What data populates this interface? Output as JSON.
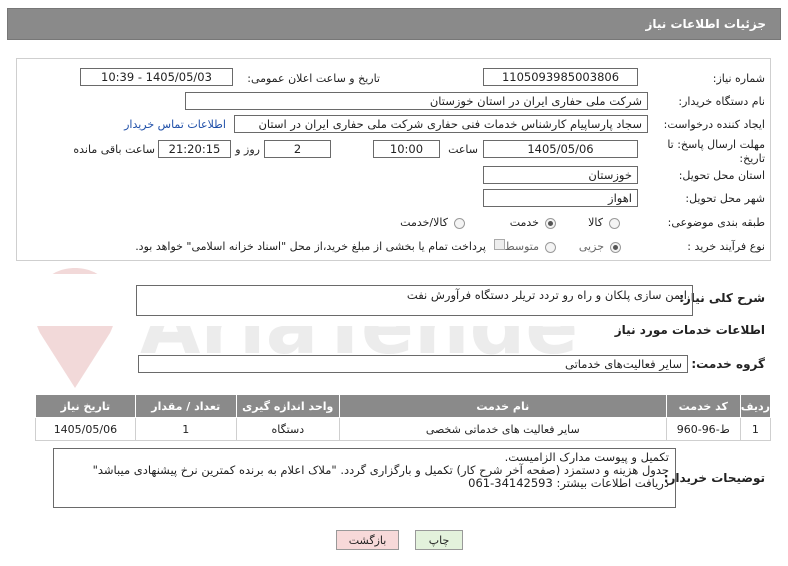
{
  "header": {
    "title": "جزئیات اطلاعات نیاز"
  },
  "fields": {
    "need_number_label": "شماره نیاز:",
    "need_number": "1105093985003806",
    "announce_label": "تاریخ و ساعت اعلان عمومی:",
    "announce_value": "1405/05/03 - 10:39",
    "buyer_org_label": "نام دستگاه خریدار:",
    "buyer_org": "شرکت ملی حفاری ایران در استان خوزستان",
    "requester_label": "ایجاد کننده درخواست:",
    "requester": "سجاد پارساپیام کارشناس خدمات فنی حفاری شرکت ملی حفاری ایران در استان",
    "contact_link": "اطلاعات تماس خریدار",
    "deadline_label_1": "مهلت ارسال پاسخ: تا",
    "deadline_label_2": "تاریخ:",
    "deadline_date": "1405/05/06",
    "time_label": "ساعت",
    "deadline_time": "10:00",
    "days_value": "2",
    "days_label": "روز و",
    "remaining_time": "21:20:15",
    "remaining_label": "ساعت باقی مانده",
    "province_label": "استان محل تحویل:",
    "province": "خوزستان",
    "city_label": "شهر محل تحویل:",
    "city": "اهواز",
    "category_label": "طبقه بندی موضوعی:",
    "category_options": [
      "کالا",
      "خدمت",
      "کالا/خدمت"
    ],
    "category_selected": "خدمت",
    "purchase_type_label": "نوع فرآیند خرید :",
    "purchase_options": [
      "جزیی",
      "متوسط"
    ],
    "purchase_selected": "جزیی",
    "payment_note": "پرداخت تمام یا بخشی از مبلغ خرید،از محل \"اسناد خزانه اسلامی\" خواهد بود."
  },
  "summary": {
    "label": "شرح کلی نیاز:",
    "value": "ایمن سازی پلکان و راه رو تردد تریلر دستگاه فرآورش نفت"
  },
  "services_title": "اطلاعات خدمات مورد نیاز",
  "service_group": {
    "label": "گروه خدمت:",
    "value": "سایر فعالیت‌های خدماتی"
  },
  "table": {
    "headers": [
      "ردیف",
      "کد خدمت",
      "نام خدمت",
      "واحد اندازه گیری",
      "تعداد / مقدار",
      "تاریخ نیاز"
    ],
    "rows": [
      [
        "1",
        "ط-96-960",
        "سایر فعالیت های خدماتی شخصی",
        "دستگاه",
        "1",
        "1405/05/06"
      ]
    ]
  },
  "buyer_notes": {
    "label": "توضیحات خریدار:",
    "line1": "تکمیل و پیوست مدارک الزامیست.",
    "line2": "جدول هزینه و دستمزد (صفحه آخر شرح کار) تکمیل و بارگزاری گردد. \"ملاک اعلام به برنده کمترین نرخ پیشنهادی میباشد\"",
    "line3": "دریافت اطلاعات بیشتر: 34142593-061"
  },
  "buttons": {
    "print": "چاپ",
    "back": "بازگشت"
  },
  "colors": {
    "header_bg": "#8a8a8a",
    "link": "#1f4fa8",
    "back_btn_bg": "#f7d9d9",
    "print_btn_bg": "#e3f2dc"
  },
  "watermark": {
    "text": "AriaTender.net"
  }
}
